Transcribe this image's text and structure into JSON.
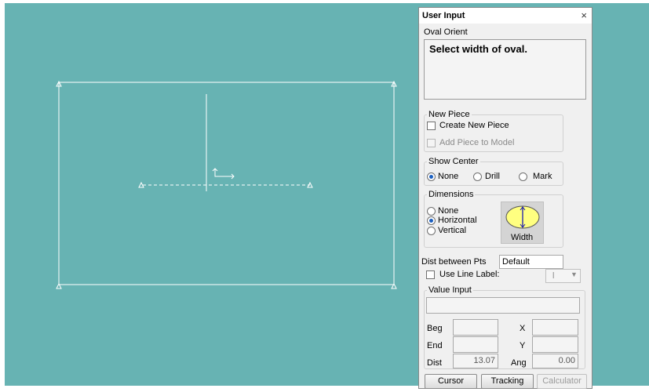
{
  "dialog": {
    "title": "User Input",
    "close_glyph": "×",
    "subtitle": "Oval Orient",
    "prompt": "Select width of oval."
  },
  "new_piece": {
    "legend": "New Piece",
    "create_label": "Create New Piece",
    "create_checked": false,
    "add_label": "Add Piece to Model",
    "add_enabled": false
  },
  "show_center": {
    "legend": "Show Center",
    "options": [
      "None",
      "Drill",
      "Mark"
    ],
    "selected": "None"
  },
  "dimensions": {
    "legend": "Dimensions",
    "options": [
      "None",
      "Horizontal",
      "Vertical"
    ],
    "selected": "Horizontal",
    "preview_caption": "Width",
    "preview_fill": "#ffff80",
    "preview_arrow": "#1b1bb0"
  },
  "dist_between_pts": {
    "label": "Dist between Pts",
    "value": "Default"
  },
  "use_line_label": {
    "label": "Use Line Label:",
    "checked": false,
    "select_value": "l"
  },
  "value_input": {
    "legend": "Value Input",
    "beg_label": "Beg",
    "end_label": "End",
    "dist_label": "Dist",
    "x_label": "X",
    "y_label": "Y",
    "ang_label": "Ang",
    "dist_value": "13.07",
    "ang_value": "0.00"
  },
  "buttons": {
    "cursor": "Cursor",
    "tracking": "Tracking",
    "calculator": "Calculator"
  },
  "canvas": {
    "background": "#67b3b3",
    "line_color": "#ffffff"
  }
}
